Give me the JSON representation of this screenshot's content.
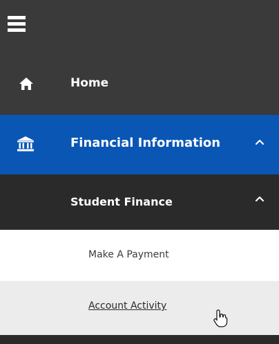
{
  "menu": {
    "toggle_icon": "hamburger-menu-icon"
  },
  "nav": {
    "home": {
      "label": "Home",
      "icon": "home-icon"
    },
    "financial_information": {
      "label": "Financial Information",
      "icon": "bank-icon",
      "expanded": true,
      "chevron": "chevron-up-icon"
    },
    "student_finance": {
      "label": "Student Finance",
      "expanded": true,
      "chevron": "chevron-up-icon"
    },
    "sub_items": [
      {
        "label": "Make A Payment"
      },
      {
        "label": "Account Activity"
      }
    ]
  },
  "colors": {
    "dark_bg": "#3a3a3a",
    "darker_bg": "#2a2a2a",
    "active_blue": "#0a56b5",
    "sub_bg": "#ffffff",
    "hover_bg": "#ececec"
  }
}
